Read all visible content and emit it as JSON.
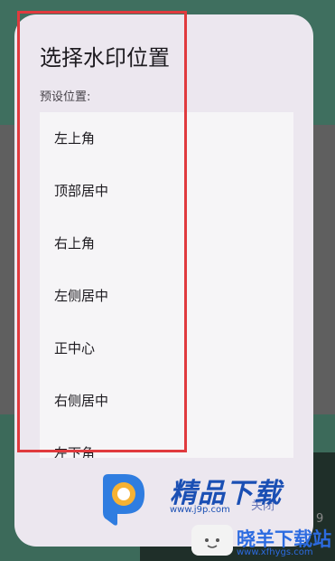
{
  "dialog": {
    "title": "选择水印位置",
    "subtitle": "预设位置:",
    "options": [
      "左上角",
      "顶部居中",
      "右上角",
      "左侧居中",
      "正中心",
      "右侧居中",
      "左下角"
    ],
    "close_label": "关闭"
  },
  "watermark": {
    "brand": "精品下载",
    "url": "www.j9p.com",
    "brand2": "晓羊下载站",
    "url2": "www.xfhygs.com",
    "corner_digit": "9"
  },
  "colors": {
    "highlight": "#e03a3e",
    "dialog_bg": "#ece7ef",
    "accent": "#6b79b9"
  }
}
